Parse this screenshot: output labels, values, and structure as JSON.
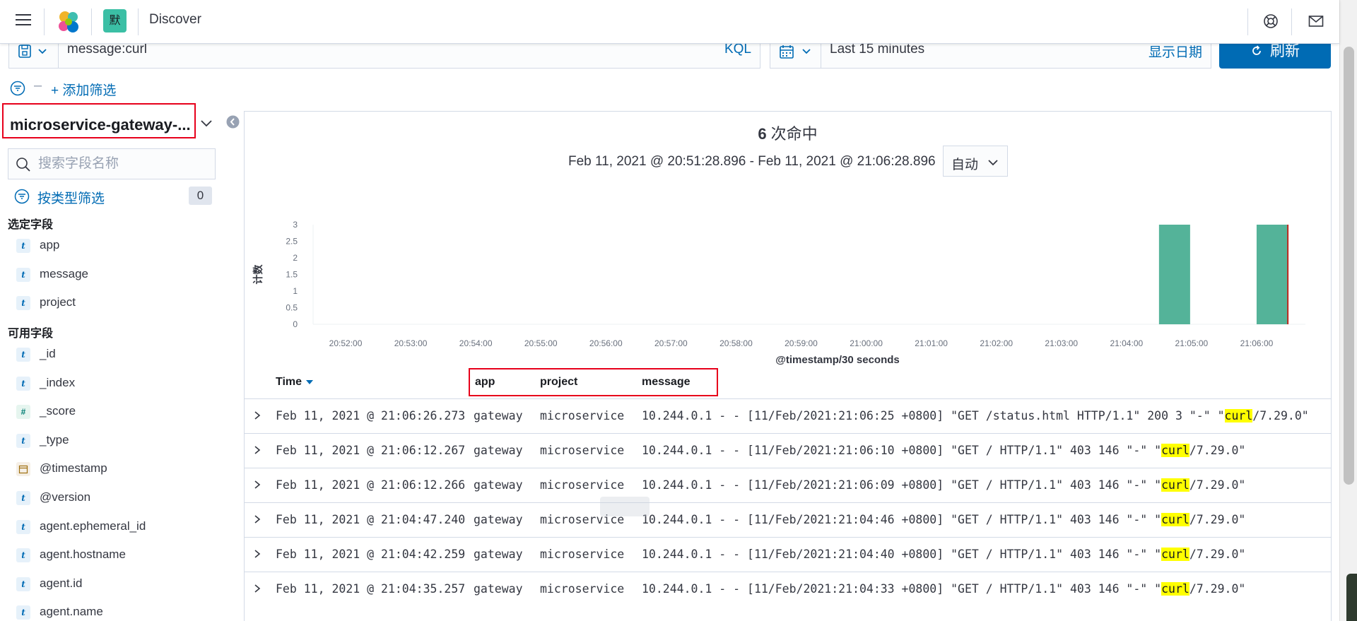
{
  "header": {
    "space_initial": "默",
    "app_title": "Discover"
  },
  "query": {
    "value": "message:curl",
    "language": "KQL"
  },
  "date_picker": {
    "range": "Last 15 minutes",
    "show_dates": "显示日期"
  },
  "refresh": {
    "label": "刷新"
  },
  "filters": {
    "add_filter": "+ 添加筛选"
  },
  "sidebar": {
    "index_pattern": "microservice-gateway-...",
    "search_placeholder": "搜索字段名称",
    "filter_by_type": "按类型筛选",
    "filter_count": "0",
    "selected_title": "选定字段",
    "selected_fields": [
      {
        "type": "t",
        "name": "app"
      },
      {
        "type": "t",
        "name": "message"
      },
      {
        "type": "t",
        "name": "project"
      }
    ],
    "available_title": "可用字段",
    "available_fields": [
      {
        "type": "t",
        "name": "_id"
      },
      {
        "type": "t",
        "name": "_index"
      },
      {
        "type": "#",
        "name": "_score"
      },
      {
        "type": "t",
        "name": "_type"
      },
      {
        "type": "date",
        "name": "@timestamp"
      },
      {
        "type": "t",
        "name": "@version"
      },
      {
        "type": "t",
        "name": "agent.ephemeral_id"
      },
      {
        "type": "t",
        "name": "agent.hostname"
      },
      {
        "type": "t",
        "name": "agent.id"
      },
      {
        "type": "t",
        "name": "agent.name"
      }
    ]
  },
  "results": {
    "hit_count": "6",
    "hit_suffix": " 次命中",
    "time_range": "Feb 11, 2021 @ 20:51:28.896 - Feb 11, 2021 @ 21:06:28.896",
    "interval": "自动"
  },
  "colors": {
    "bar": "#54b399",
    "now_line": "#bd271e",
    "accent": "#006bb4",
    "highlight_box": "#e7001b"
  },
  "chart_data": {
    "type": "bar",
    "ylabel": "计数",
    "xlabel": "@timestamp/30 seconds",
    "ylim": [
      0,
      3
    ],
    "yticks": [
      "0",
      "0.5",
      "1",
      "1.5",
      "2",
      "2.5",
      "3"
    ],
    "xticks": [
      "20:52:00",
      "20:53:00",
      "20:54:00",
      "20:55:00",
      "20:56:00",
      "20:57:00",
      "20:58:00",
      "20:59:00",
      "21:00:00",
      "21:01:00",
      "21:02:00",
      "21:03:00",
      "21:04:00",
      "21:05:00",
      "21:06:00"
    ],
    "x_start_minutes": 51.5,
    "x_end_minutes": 66.75,
    "bars": [
      {
        "start_minutes": 64.5,
        "value": 3
      },
      {
        "start_minutes": 66.0,
        "value": 3
      }
    ],
    "now_minutes": 66.48
  },
  "table": {
    "columns": {
      "time": "Time",
      "app": "app",
      "project": "project",
      "message": "message"
    },
    "rows": [
      {
        "time": "Feb 11, 2021 @ 21:06:26.273",
        "app": "gateway",
        "project": "microservice",
        "msg_pre": "10.244.0.1 - - [11/Feb/2021:21:06:25 +0800] \"GET /status.html HTTP/1.1\" 200 3 \"-\" \"",
        "msg_hl": "curl",
        "msg_post": "/7.29.0\""
      },
      {
        "time": "Feb 11, 2021 @ 21:06:12.267",
        "app": "gateway",
        "project": "microservice",
        "msg_pre": "10.244.0.1 - - [11/Feb/2021:21:06:10 +0800] \"GET / HTTP/1.1\" 403 146 \"-\" \"",
        "msg_hl": "curl",
        "msg_post": "/7.29.0\""
      },
      {
        "time": "Feb 11, 2021 @ 21:06:12.266",
        "app": "gateway",
        "project": "microservice",
        "msg_pre": "10.244.0.1 - - [11/Feb/2021:21:06:09 +0800] \"GET / HTTP/1.1\" 403 146 \"-\" \"",
        "msg_hl": "curl",
        "msg_post": "/7.29.0\""
      },
      {
        "time": "Feb 11, 2021 @ 21:04:47.240",
        "app": "gateway",
        "project": "microservice",
        "msg_pre": "10.244.0.1 - - [11/Feb/2021:21:04:46 +0800] \"GET / HTTP/1.1\" 403 146 \"-\" \"",
        "msg_hl": "curl",
        "msg_post": "/7.29.0\""
      },
      {
        "time": "Feb 11, 2021 @ 21:04:42.259",
        "app": "gateway",
        "project": "microservice",
        "msg_pre": "10.244.0.1 - - [11/Feb/2021:21:04:40 +0800] \"GET / HTTP/1.1\" 403 146 \"-\" \"",
        "msg_hl": "curl",
        "msg_post": "/7.29.0\""
      },
      {
        "time": "Feb 11, 2021 @ 21:04:35.257",
        "app": "gateway",
        "project": "microservice",
        "msg_pre": "10.244.0.1 - - [11/Feb/2021:21:04:33 +0800] \"GET / HTTP/1.1\" 403 146 \"-\" \"",
        "msg_hl": "curl",
        "msg_post": "/7.29.0\""
      }
    ]
  }
}
